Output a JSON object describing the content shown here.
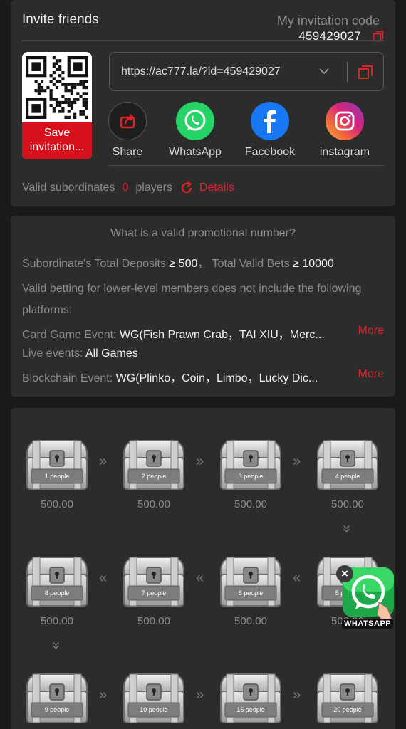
{
  "invite": {
    "title": "Invite friends",
    "code_label": "My invitation code",
    "code_value": "459429027",
    "save_label": "Save invitation...",
    "url": "https://ac777.la/?id=459429027",
    "share_options": [
      {
        "label": "Share",
        "icon": "share-icon",
        "color": "#1f1f1f"
      },
      {
        "label": "WhatsApp",
        "icon": "whatsapp-icon",
        "color": "#25d366"
      },
      {
        "label": "Facebook",
        "icon": "facebook-icon",
        "color": "#1877f2"
      },
      {
        "label": "instagram",
        "icon": "instagram-icon",
        "color": "#e1306c"
      }
    ],
    "valid_label": "Valid subordinates",
    "valid_count": "0",
    "players_label": "players",
    "details_label": "Details"
  },
  "rules": {
    "title": "What is a valid promotional number?",
    "deposits_label": "Subordinate's Total Deposits",
    "deposits_value": "≥ 500",
    "sep": "，",
    "bets_label": "Total Valid Bets",
    "bets_value": "≥ 10000",
    "note": "Valid betting for lower-level members does not include the following platforms:",
    "card_label": "Card Game Event:",
    "card_value": "WG(Fish Prawn Crab，TAI XIU，Merc...",
    "live_label": "Live events:",
    "live_value": "All Games",
    "chain_label": "Blockchain Event:",
    "chain_value": "WG(Plinko，Coin，Limbo，Lucky Dic...",
    "more_label": "More"
  },
  "chests": [
    {
      "label": "1 people",
      "amount": "500.00"
    },
    {
      "label": "2 people",
      "amount": "500.00"
    },
    {
      "label": "3 people",
      "amount": "500.00"
    },
    {
      "label": "4 people",
      "amount": "500.00"
    },
    {
      "label": "5 people",
      "amount": "500.00"
    },
    {
      "label": "6 people",
      "amount": "500.00"
    },
    {
      "label": "7 people",
      "amount": "500.00"
    },
    {
      "label": "8 people",
      "amount": "500.00"
    },
    {
      "label": "9 people",
      "amount": ""
    },
    {
      "label": "10 people",
      "amount": ""
    },
    {
      "label": "15 people",
      "amount": ""
    },
    {
      "label": "20 people",
      "amount": ""
    }
  ],
  "float": {
    "label": "WHATSAPP",
    "close": "×"
  },
  "colors": {
    "accent": "#e0222a",
    "card_bg": "#2c2c2c",
    "page_bg": "#1a1a1a"
  }
}
